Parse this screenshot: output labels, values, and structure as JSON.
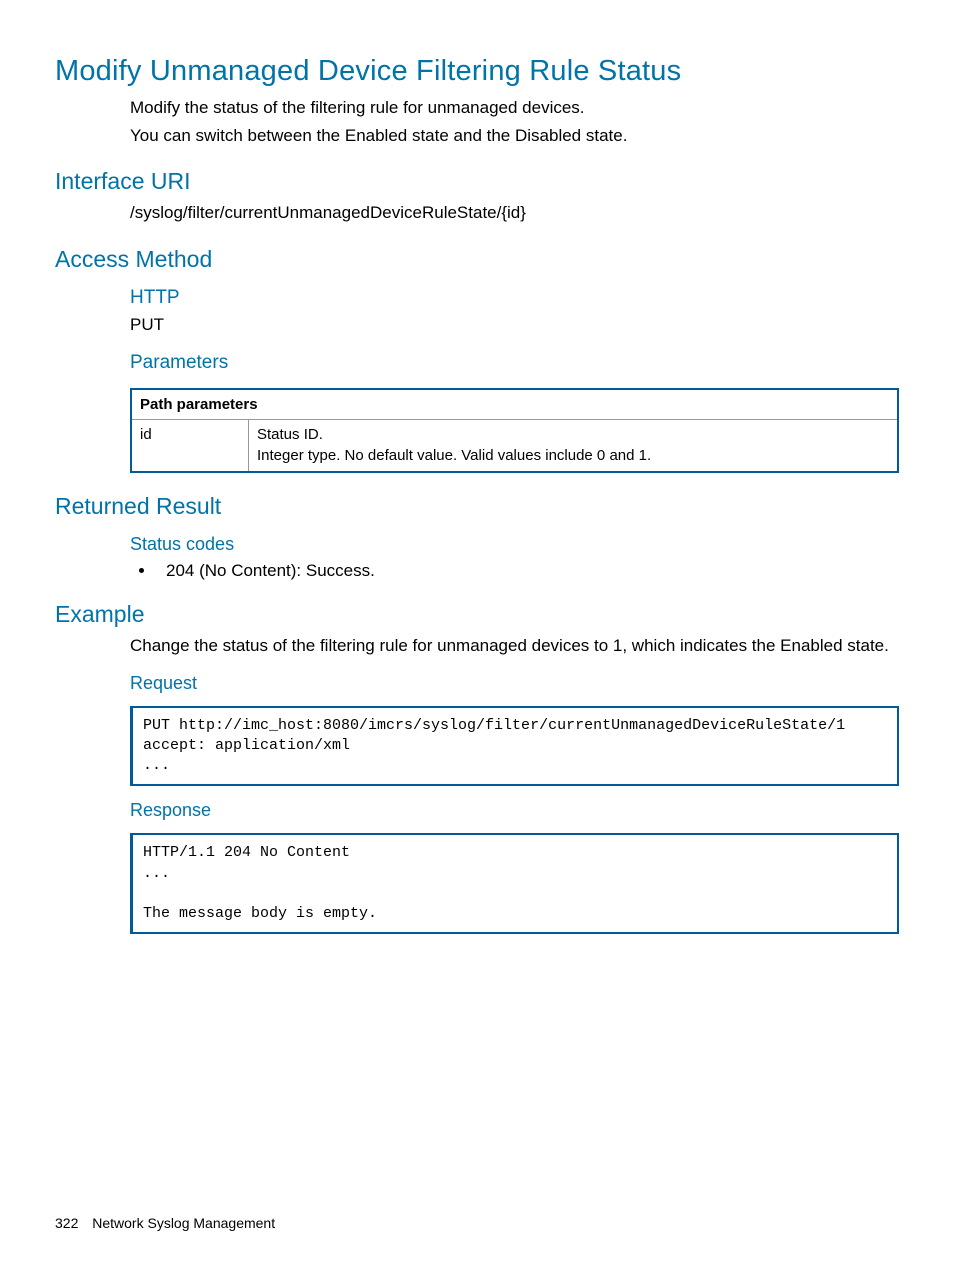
{
  "title": "Modify Unmanaged Device Filtering Rule Status",
  "intro": {
    "p1": "Modify the status of the filtering rule for unmanaged devices.",
    "p2": "You can switch between the Enabled state and the Disabled state."
  },
  "sections": {
    "interface_uri": {
      "heading": "Interface URI",
      "value": "/syslog/filter/currentUnmanagedDeviceRuleState/{id}"
    },
    "access_method": {
      "heading": "Access Method",
      "http": {
        "heading": "HTTP",
        "value": "PUT"
      },
      "parameters": {
        "heading": "Parameters",
        "table_header": "Path parameters",
        "row": {
          "key": "id",
          "desc_l1": "Status ID.",
          "desc_l2": "Integer type. No default value. Valid values include 0 and 1."
        }
      }
    },
    "returned_result": {
      "heading": "Returned Result",
      "status_codes": {
        "heading": "Status codes",
        "item": "204 (No Content): Success."
      }
    },
    "example": {
      "heading": "Example",
      "desc": "Change the status of the filtering rule for unmanaged devices to 1, which indicates the Enabled state.",
      "request": {
        "heading": "Request",
        "code": "PUT http://imc_host:8080/imcrs/syslog/filter/currentUnmanagedDeviceRuleState/1\naccept: application/xml\n..."
      },
      "response": {
        "heading": "Response",
        "code": "HTTP/1.1 204 No Content\n...\n\nThe message body is empty."
      }
    }
  },
  "footer": {
    "page": "322",
    "section": "Network Syslog Management"
  }
}
